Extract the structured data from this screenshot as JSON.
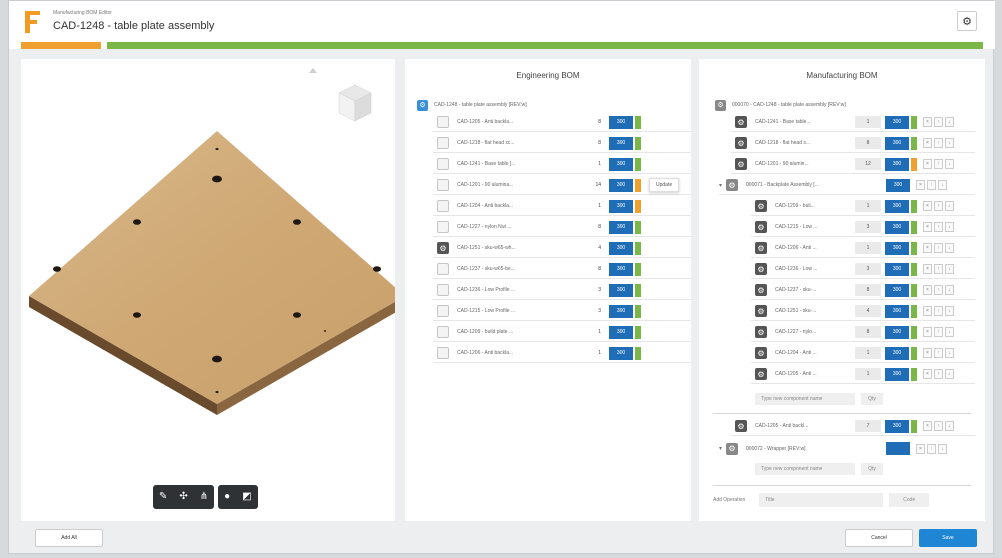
{
  "header": {
    "app_subtitle": "Manufacturing BOM Editor",
    "title": "CAD-1248 - table plate assembly",
    "settings_icon": "gear-icon"
  },
  "colors": {
    "accent_blue": "#1f6db6",
    "progress_orange": "#f0a030",
    "progress_green": "#7ab648",
    "flag_green": "#7ab648",
    "flag_orange": "#f0a030"
  },
  "viewer": {
    "toolbar": [
      "pencil-icon",
      "explode-icon",
      "tree-icon",
      "circle-icon",
      "square-icon"
    ]
  },
  "ebom": {
    "title": "Engineering BOM",
    "root_label": "CAD-1248 - table plate assembly [REV:w]",
    "rows": [
      {
        "name": "CAD-1205 - Anti backla...",
        "qty": "8",
        "btn": "300",
        "flag": "green"
      },
      {
        "name": "CAD-1218 - flat head sc...",
        "qty": "8",
        "btn": "300",
        "flag": "green"
      },
      {
        "name": "CAD-1241 - Base table [...",
        "qty": "1",
        "btn": "300",
        "flag": "green"
      },
      {
        "name": "CAD-1201 - 90 alumina...",
        "qty": "14",
        "btn": "300",
        "flag": "orange",
        "tooltip": "Update"
      },
      {
        "name": "CAD-1204 - Anti backla...",
        "qty": "1",
        "btn": "300",
        "flag": "orange"
      },
      {
        "name": "CAD-1227 - nylon Nut ...",
        "qty": "8",
        "btn": "300",
        "flag": "green"
      },
      {
        "name": "CAD-1251 - sku-w65-wh...",
        "qty": "4",
        "btn": "300",
        "flag": "green"
      },
      {
        "name": "CAD-1237 - sku-w65-be...",
        "qty": "8",
        "btn": "300",
        "flag": "green"
      },
      {
        "name": "CAD-1236 - Low Profile ...",
        "qty": "3",
        "btn": "300",
        "flag": "green"
      },
      {
        "name": "CAD-1215 - Low Profile ...",
        "qty": "3",
        "btn": "300",
        "flag": "green"
      },
      {
        "name": "CAD-1209 - build plate ...",
        "qty": "1",
        "btn": "300",
        "flag": "green"
      },
      {
        "name": "CAD-1206 - Anti backla...",
        "qty": "1",
        "btn": "300",
        "flag": "green"
      }
    ]
  },
  "mbom": {
    "title": "Manufacturing BOM",
    "root_label": "000070 - CAD-1248 - table plate assembly [REV:w]",
    "top_rows": [
      {
        "name": "CAD-1241 - Base table...",
        "qty": "1",
        "btn": "300",
        "flag": "green"
      },
      {
        "name": "CAD-1218 - flat head s...",
        "qty": "8",
        "btn": "300",
        "flag": "green"
      },
      {
        "name": "CAD-1201 - 90 alumin...",
        "qty": "12",
        "btn": "300",
        "flag": "orange"
      }
    ],
    "backplate": {
      "name": "000071 - Backplate Assembly [...",
      "btn": "300"
    },
    "backplate_rows": [
      {
        "name": "CAD-1209 - buil...",
        "qty": "1",
        "btn": "300"
      },
      {
        "name": "CAD-1215 - Low ...",
        "qty": "3",
        "btn": "300"
      },
      {
        "name": "CAD-1206 - Anti ...",
        "qty": "1",
        "btn": "300"
      },
      {
        "name": "CAD-1236 - Low ...",
        "qty": "3",
        "btn": "300"
      },
      {
        "name": "CAD-1237 - sku-...",
        "qty": "8",
        "btn": "300"
      },
      {
        "name": "CAD-1251 - sku-...",
        "qty": "4",
        "btn": "300"
      },
      {
        "name": "CAD-1227 - nylo...",
        "qty": "8",
        "btn": "300"
      },
      {
        "name": "CAD-1204 - Anti ...",
        "qty": "1",
        "btn": "300"
      },
      {
        "name": "CAD-1205 - Anti ...",
        "qty": "1",
        "btn": "300"
      }
    ],
    "new_component_placeholder": "Type new component name",
    "new_component_qty": "Qty",
    "anti_row": {
      "name": "CAD-1205 - Anti backl...",
      "qty": "7",
      "btn": "300",
      "flag": "green"
    },
    "wrapper": {
      "name": "000072 - Wrapper [REV:w]"
    },
    "new_component_placeholder_2": "Type new component name",
    "new_component_qty_2": "Qty",
    "add_operation_label": "Add Operation",
    "add_operation_title": "Title",
    "add_operation_code": "Code"
  },
  "footer": {
    "add_all": "Add All",
    "cancel": "Cancel",
    "save": "Save"
  }
}
